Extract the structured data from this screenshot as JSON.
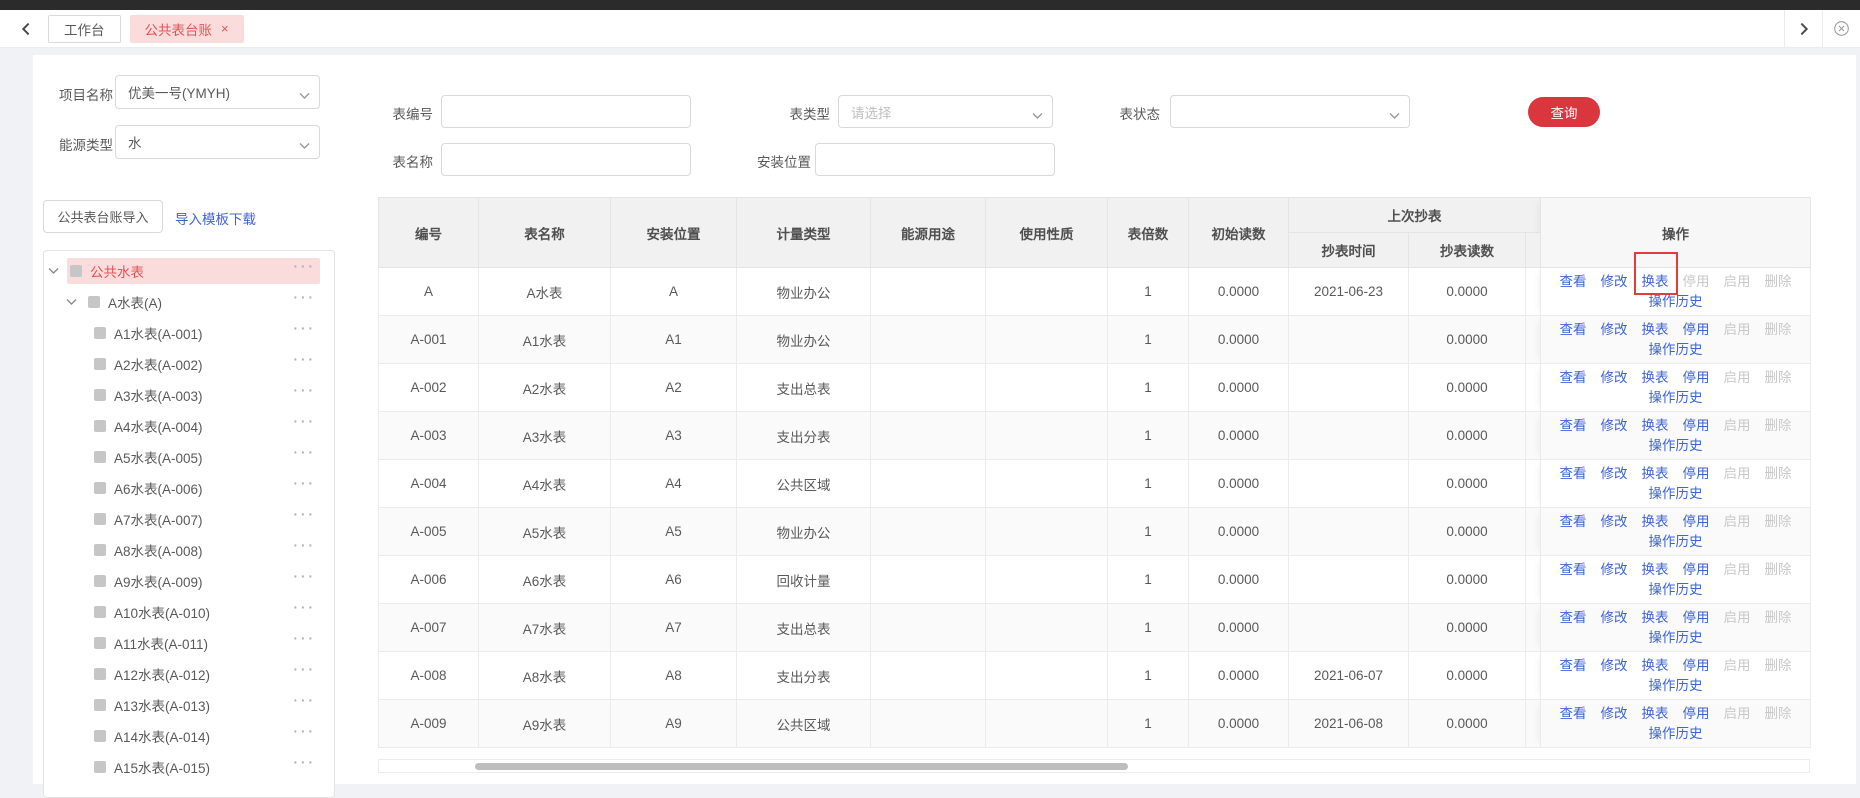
{
  "tab_bar": {
    "back_icon": "chevron-left",
    "forward_icon": "chevron-right",
    "close_all_icon": "circle-x",
    "tabs": [
      {
        "label": "工作台",
        "active": false,
        "closable": false
      },
      {
        "label": "公共表台账",
        "active": true,
        "closable": true,
        "close_icon": "×"
      }
    ]
  },
  "sidebar": {
    "filters": [
      {
        "label": "项目名称",
        "value": "优美一号(YMYH)"
      },
      {
        "label": "能源类型",
        "value": "水"
      }
    ],
    "import_button_label": "公共表台账导入",
    "template_download_link": "导入模板下载",
    "tree": {
      "items": [
        {
          "label": "公共水表",
          "level": 0,
          "selected": true,
          "expanded": true
        },
        {
          "label": "A水表(A)",
          "level": 1,
          "selected": false,
          "expanded": true
        },
        {
          "label": "A1水表(A-001)",
          "level": 2
        },
        {
          "label": "A2水表(A-002)",
          "level": 2
        },
        {
          "label": "A3水表(A-003)",
          "level": 2
        },
        {
          "label": "A4水表(A-004)",
          "level": 2
        },
        {
          "label": "A5水表(A-005)",
          "level": 2
        },
        {
          "label": "A6水表(A-006)",
          "level": 2
        },
        {
          "label": "A7水表(A-007)",
          "level": 2
        },
        {
          "label": "A8水表(A-008)",
          "level": 2
        },
        {
          "label": "A9水表(A-009)",
          "level": 2
        },
        {
          "label": "A10水表(A-010)",
          "level": 2
        },
        {
          "label": "A11水表(A-011)",
          "level": 2
        },
        {
          "label": "A12水表(A-012)",
          "level": 2
        },
        {
          "label": "A13水表(A-013)",
          "level": 2
        },
        {
          "label": "A14水表(A-014)",
          "level": 2
        },
        {
          "label": "A15水表(A-015)",
          "level": 2
        }
      ]
    }
  },
  "search_form": {
    "fields": {
      "meter_no_label": "表编号",
      "meter_type_label": "表类型",
      "meter_type_placeholder": "请选择",
      "meter_status_label": "表状态",
      "meter_name_label": "表名称",
      "install_location_label": "安装位置"
    },
    "search_button_label": "查询"
  },
  "table": {
    "columns": [
      "编号",
      "表名称",
      "安装位置",
      "计量类型",
      "能源用途",
      "使用性质",
      "表倍数",
      "初始读数"
    ],
    "group_header": {
      "label": "上次抄表",
      "children": [
        "抄表时间",
        "抄表读数"
      ]
    },
    "actions_column_label": "操作",
    "action_labels": [
      "查看",
      "修改",
      "换表",
      "停用",
      "启用",
      "删除"
    ],
    "action_names": {
      "查看": "view",
      "修改": "edit",
      "换表": "replace-meter",
      "停用": "disable",
      "启用": "enable",
      "删除": "delete"
    },
    "action_history_label": "操作历史",
    "rows": [
      {
        "no": "A",
        "name": "A水表",
        "location": "A",
        "metering_type": "物业办公",
        "energy_use": "",
        "usage_nature": "",
        "multiplier": "1",
        "initial_reading": "0.0000",
        "read_time": "2021-06-23",
        "read_value": "0.0000",
        "disabled_actions": [
          "停用",
          "启用",
          "删除"
        ],
        "annotated_action": "换表"
      },
      {
        "no": "A-001",
        "name": "A1水表",
        "location": "A1",
        "metering_type": "物业办公",
        "energy_use": "",
        "usage_nature": "",
        "multiplier": "1",
        "initial_reading": "0.0000",
        "read_time": "",
        "read_value": "0.0000",
        "disabled_actions": [
          "启用",
          "删除"
        ]
      },
      {
        "no": "A-002",
        "name": "A2水表",
        "location": "A2",
        "metering_type": "支出总表",
        "energy_use": "",
        "usage_nature": "",
        "multiplier": "1",
        "initial_reading": "0.0000",
        "read_time": "",
        "read_value": "0.0000",
        "disabled_actions": [
          "启用",
          "删除"
        ]
      },
      {
        "no": "A-003",
        "name": "A3水表",
        "location": "A3",
        "metering_type": "支出分表",
        "energy_use": "",
        "usage_nature": "",
        "multiplier": "1",
        "initial_reading": "0.0000",
        "read_time": "",
        "read_value": "0.0000",
        "disabled_actions": [
          "启用",
          "删除"
        ]
      },
      {
        "no": "A-004",
        "name": "A4水表",
        "location": "A4",
        "metering_type": "公共区域",
        "energy_use": "",
        "usage_nature": "",
        "multiplier": "1",
        "initial_reading": "0.0000",
        "read_time": "",
        "read_value": "0.0000",
        "disabled_actions": [
          "启用",
          "删除"
        ]
      },
      {
        "no": "A-005",
        "name": "A5水表",
        "location": "A5",
        "metering_type": "物业办公",
        "energy_use": "",
        "usage_nature": "",
        "multiplier": "1",
        "initial_reading": "0.0000",
        "read_time": "",
        "read_value": "0.0000",
        "disabled_actions": [
          "启用",
          "删除"
        ]
      },
      {
        "no": "A-006",
        "name": "A6水表",
        "location": "A6",
        "metering_type": "回收计量",
        "energy_use": "",
        "usage_nature": "",
        "multiplier": "1",
        "initial_reading": "0.0000",
        "read_time": "",
        "read_value": "0.0000",
        "disabled_actions": [
          "启用",
          "删除"
        ]
      },
      {
        "no": "A-007",
        "name": "A7水表",
        "location": "A7",
        "metering_type": "支出总表",
        "energy_use": "",
        "usage_nature": "",
        "multiplier": "1",
        "initial_reading": "0.0000",
        "read_time": "",
        "read_value": "0.0000",
        "disabled_actions": [
          "启用",
          "删除"
        ]
      },
      {
        "no": "A-008",
        "name": "A8水表",
        "location": "A8",
        "metering_type": "支出分表",
        "energy_use": "",
        "usage_nature": "",
        "multiplier": "1",
        "initial_reading": "0.0000",
        "read_time": "2021-06-07",
        "read_value": "0.0000",
        "disabled_actions": [
          "启用",
          "删除"
        ]
      },
      {
        "no": "A-009",
        "name": "A9水表",
        "location": "A9",
        "metering_type": "公共区域",
        "energy_use": "",
        "usage_nature": "",
        "multiplier": "1",
        "initial_reading": "0.0000",
        "read_time": "2021-06-08",
        "read_value": "0.0000",
        "disabled_actions": [
          "启用",
          "删除"
        ]
      }
    ]
  },
  "colors": {
    "accent_red": "#d9363e",
    "link_blue": "#3d63d8",
    "tab_active_bg": "#fbdcdc",
    "tab_active_text": "#e25454",
    "annotation_red": "#e23c3c",
    "disabled_gray": "#c8c8c8",
    "topbar": "#2b2b2b"
  }
}
